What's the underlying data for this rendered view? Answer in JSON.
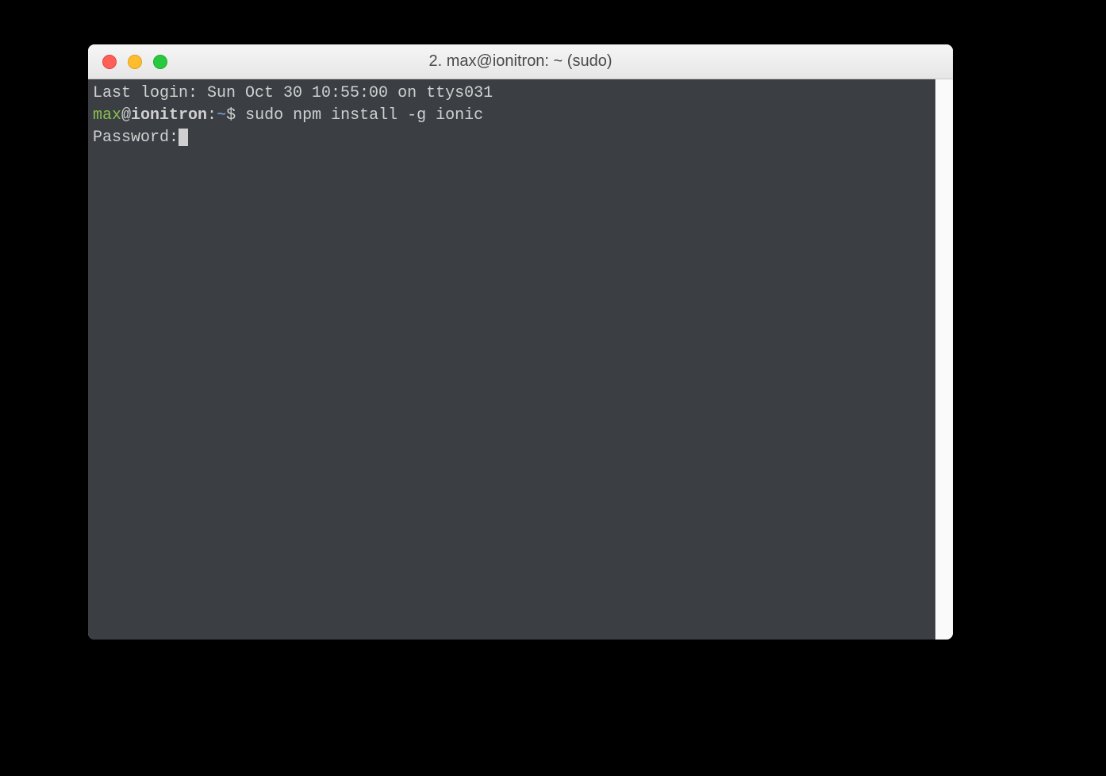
{
  "window": {
    "title": "2. max@ionitron: ~  (sudo)"
  },
  "terminal": {
    "last_login": "Last login: Sun Oct 30 10:55:00 on ttys031",
    "prompt": {
      "user": "max",
      "at": "@",
      "host": "ionitron",
      "colon": ":",
      "path": "~",
      "symbol": "$"
    },
    "command": "sudo npm install -g ionic",
    "password_label": "Password:"
  }
}
